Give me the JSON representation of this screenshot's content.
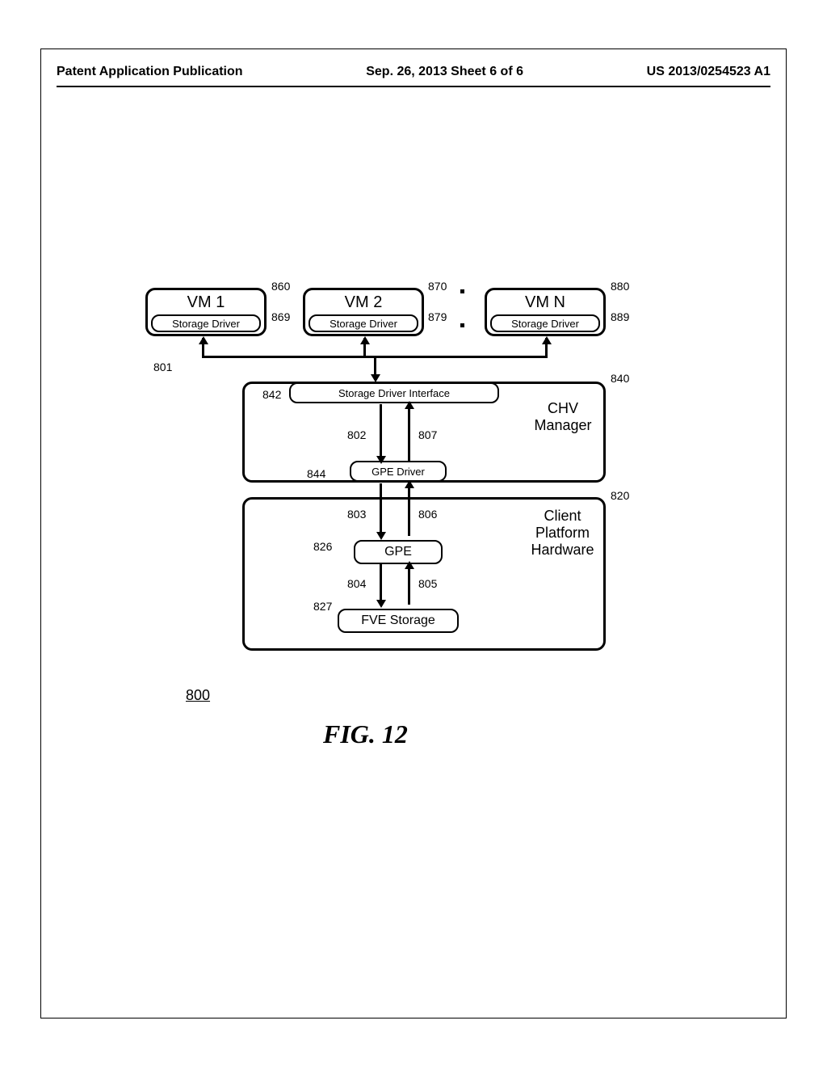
{
  "header": {
    "left": "Patent Application Publication",
    "center": "Sep. 26, 2013  Sheet 6 of 6",
    "right": "US 2013/0254523 A1"
  },
  "boxes": {
    "vm1": {
      "title": "VM 1",
      "driver": "Storage Driver",
      "ref": "860",
      "driver_ref": "869"
    },
    "vm2": {
      "title": "VM 2",
      "driver": "Storage Driver",
      "ref": "870",
      "driver_ref": "879"
    },
    "vmn": {
      "title": "VM N",
      "driver": "Storage Driver",
      "ref": "880",
      "driver_ref": "889"
    },
    "chv": {
      "title": "CHV Manager",
      "sdi": "Storage Driver Interface",
      "gpe_driver": "GPE Driver",
      "ref": "840",
      "sdi_ref": "842",
      "gpe_ref": "844"
    },
    "hw": {
      "title": "Client Platform Hardware",
      "gpe": "GPE",
      "fve": "FVE Storage",
      "ref": "820",
      "gpe_ref": "826",
      "fve_ref": "827"
    }
  },
  "refs": {
    "bus": "801",
    "a802": "802",
    "a807": "807",
    "a803": "803",
    "a806": "806",
    "a804": "804",
    "a805": "805"
  },
  "figure": {
    "number": "800",
    "title": "FIG. 12"
  }
}
